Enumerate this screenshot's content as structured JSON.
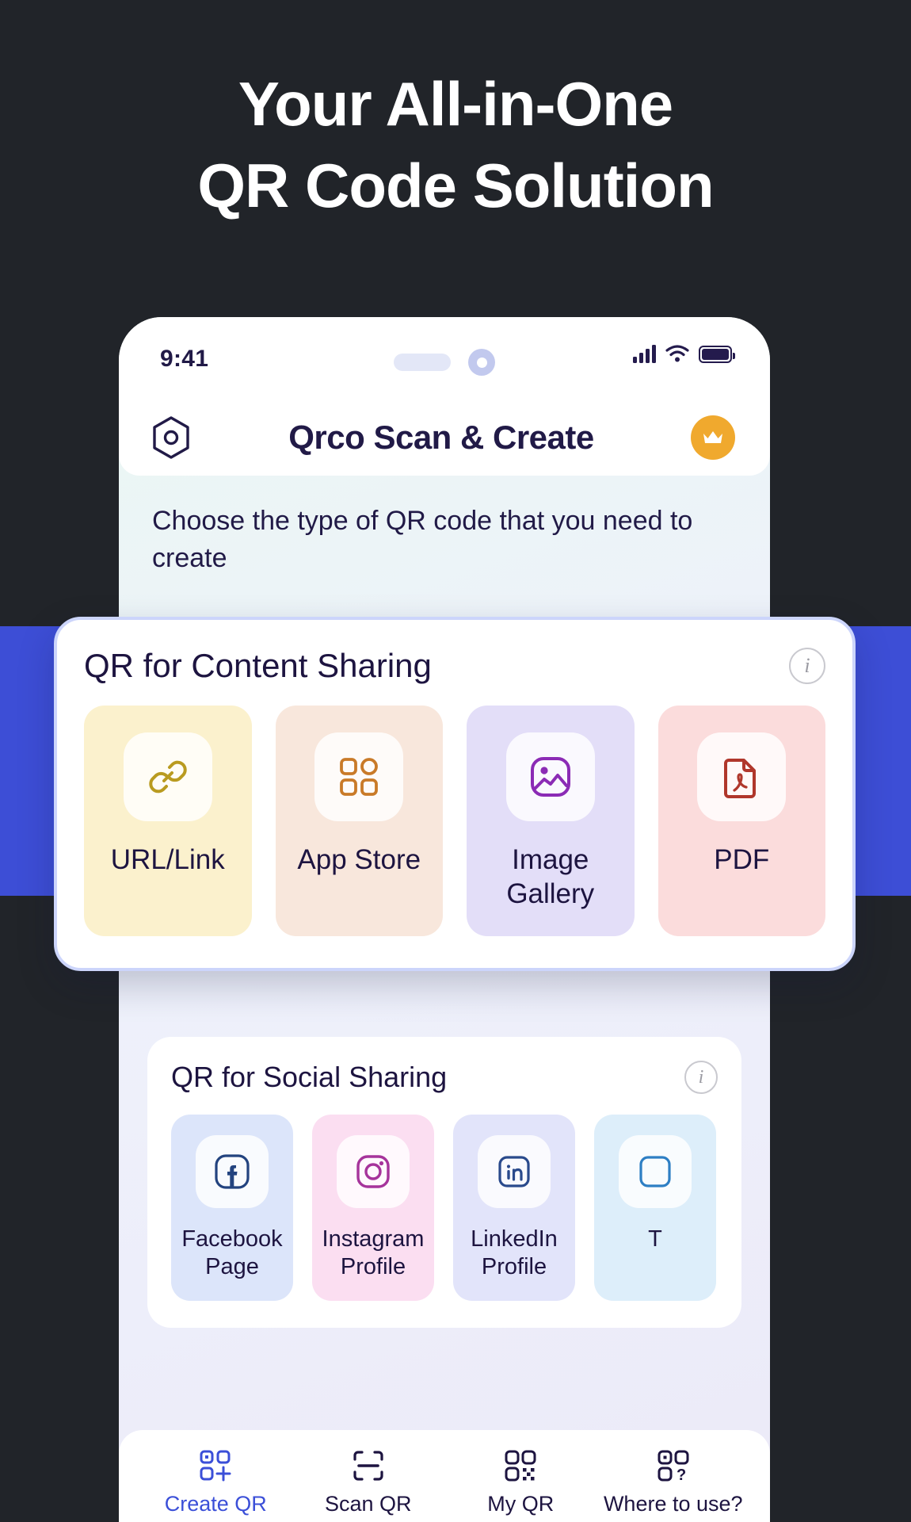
{
  "headline": {
    "line1": "Your All-in-One",
    "line2": "QR Code Solution"
  },
  "colors": {
    "page_background": "#212429",
    "band_blue": "#3D4ED6",
    "accent_navy": "#211a47",
    "active_nav": "#3B4FD8",
    "crown_badge": "#F0A92E"
  },
  "phone": {
    "statusbar": {
      "time": "9:41",
      "signal_icon": "cellular-bars-icon",
      "wifi_icon": "wifi-icon",
      "battery_icon": "battery-full-icon"
    },
    "appbar": {
      "logo_icon": "hexagon-logo-icon",
      "title": "Qrco Scan & Create",
      "premium_icon": "crown-icon"
    },
    "subtitle": "Choose the type of QR code that you need to create"
  },
  "content_sharing": {
    "title": "QR for Content Sharing",
    "info_icon": "info-icon",
    "tiles": [
      {
        "label": "URL/Link",
        "icon": "link-icon",
        "bg": "#FBF1CD",
        "icon_color": "#B99B20"
      },
      {
        "label": "App Store",
        "icon": "grid-apps-icon",
        "bg": "#F8E7DC",
        "icon_color": "#C97A28"
      },
      {
        "label": "Image Gallery",
        "icon": "image-icon",
        "bg": "#E3DEF8",
        "icon_color": "#8B2BB5"
      },
      {
        "label": "PDF",
        "icon": "pdf-file-icon",
        "bg": "#FBDCDC",
        "icon_color": "#B0372C"
      }
    ]
  },
  "social_sharing": {
    "title": "QR for Social Sharing",
    "info_icon": "info-icon",
    "tiles": [
      {
        "label": "Facebook Page",
        "icon": "facebook-icon",
        "bg": "#DCE5FA",
        "icon_color": "#23437F"
      },
      {
        "label": "Instagram Profile",
        "icon": "instagram-icon",
        "bg": "#FBDEF1",
        "icon_color": "#A6349B"
      },
      {
        "label": "LinkedIn Profile",
        "icon": "linkedin-icon",
        "bg": "#E2E4FA",
        "icon_color": "#2A4A8C"
      },
      {
        "label": "T",
        "icon": "twitter-icon",
        "bg": "#DDEEFA",
        "icon_color": "#2E7FC4"
      }
    ]
  },
  "bottom_nav": {
    "items": [
      {
        "label": "Create QR",
        "icon": "qr-plus-icon",
        "active": true
      },
      {
        "label": "Scan QR",
        "icon": "qr-scan-icon",
        "active": false
      },
      {
        "label": "My QR",
        "icon": "qr-code-icon",
        "active": false
      },
      {
        "label": "Where to use?",
        "icon": "qr-question-icon",
        "active": false
      }
    ]
  }
}
